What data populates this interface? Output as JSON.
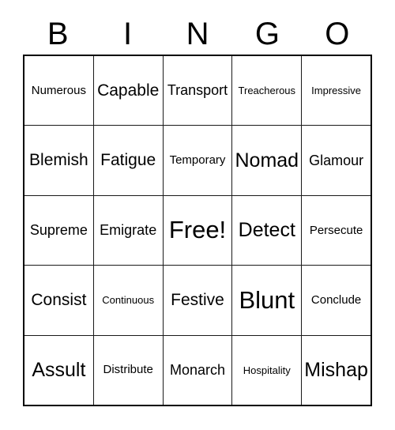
{
  "header": {
    "letters": [
      "B",
      "I",
      "N",
      "G",
      "O"
    ]
  },
  "grid": {
    "rows": [
      [
        {
          "label": "Numerous",
          "size": "xs"
        },
        {
          "label": "Capable",
          "size": "md"
        },
        {
          "label": "Transport",
          "size": "sm"
        },
        {
          "label": "Treacherous",
          "size": "xxs"
        },
        {
          "label": "Impressive",
          "size": "xxs"
        }
      ],
      [
        {
          "label": "Blemish",
          "size": "md"
        },
        {
          "label": "Fatigue",
          "size": "md"
        },
        {
          "label": "Temporary",
          "size": "xs"
        },
        {
          "label": "Nomad",
          "size": "lg"
        },
        {
          "label": "Glamour",
          "size": "sm"
        }
      ],
      [
        {
          "label": "Supreme",
          "size": "sm"
        },
        {
          "label": "Emigrate",
          "size": "sm"
        },
        {
          "label": "Free!",
          "size": "xl"
        },
        {
          "label": "Detect",
          "size": "lg"
        },
        {
          "label": "Persecute",
          "size": "xs"
        }
      ],
      [
        {
          "label": "Consist",
          "size": "md"
        },
        {
          "label": "Continuous",
          "size": "xxs"
        },
        {
          "label": "Festive",
          "size": "md"
        },
        {
          "label": "Blunt",
          "size": "xl"
        },
        {
          "label": "Conclude",
          "size": "xs"
        }
      ],
      [
        {
          "label": "Assult",
          "size": "lg"
        },
        {
          "label": "Distribute",
          "size": "xs"
        },
        {
          "label": "Monarch",
          "size": "sm"
        },
        {
          "label": "Hospitality",
          "size": "xxs"
        },
        {
          "label": "Mishap",
          "size": "lg"
        }
      ]
    ]
  },
  "colors": {
    "background": "#ffffff",
    "text": "#000000",
    "border_outer": "#000000",
    "border_inner": "#1a1a1a"
  }
}
